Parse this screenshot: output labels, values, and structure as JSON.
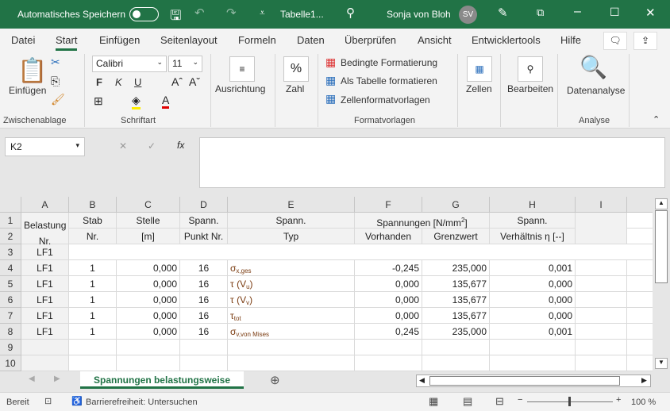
{
  "titlebar": {
    "autosave_label": "Automatisches Speichern",
    "filename": "Tabelle1...",
    "user": "Sonja von Bloh",
    "user_initials": "SV"
  },
  "tabs": [
    "Datei",
    "Start",
    "Einfügen",
    "Seitenlayout",
    "Formeln",
    "Daten",
    "Überprüfen",
    "Ansicht",
    "Entwicklertools",
    "Hilfe"
  ],
  "ribbon": {
    "paste": "Einfügen",
    "font_name": "Calibri",
    "font_size": "11",
    "bold": "F",
    "italic": "K",
    "underline": "U",
    "alignment": "Ausrichtung",
    "number": "Zahl",
    "percent": "%",
    "cond_format": "Bedingte Formatierung",
    "as_table": "Als Tabelle formatieren",
    "cell_styles": "Zellenformatvorlagen",
    "cells": "Zellen",
    "editing": "Bearbeiten",
    "data_analysis": "Datenanalyse",
    "groups": {
      "clipboard": "Zwischenablage",
      "font": "Schriftart",
      "styles": "Formatvorlagen",
      "analysis": "Analyse"
    }
  },
  "formula_bar": {
    "name_box": "K2",
    "fx": "fx",
    "value": ""
  },
  "columns": [
    "A",
    "B",
    "C",
    "D",
    "E",
    "F",
    "G",
    "H",
    "I"
  ],
  "rows": [
    "1",
    "2",
    "3",
    "4",
    "5",
    "6",
    "7",
    "8",
    "9",
    "10"
  ],
  "headers": {
    "a": "Belastung",
    "a2": "Nr.",
    "b": "Stab",
    "b2": "Nr.",
    "c": "Stelle",
    "c2": "[m]",
    "d": "Spann.",
    "d2": "Punkt Nr.",
    "e": "Spann.",
    "e2": "Typ",
    "fg": "Spannungen [N/mm",
    "fg_sup": "2",
    "fg_end": "]",
    "f2": "Vorhanden",
    "g2": "Grenzwert",
    "h": "Spann.",
    "h2": "Verhältnis η [--]"
  },
  "row3": {
    "a": "LF1"
  },
  "data": [
    {
      "a": "LF1",
      "b": "1",
      "c": "0,000",
      "d": "16",
      "type": "σ",
      "sub": "x,ges",
      "tail": "",
      "f": "-0,245",
      "g": "235,000",
      "h": "0,001"
    },
    {
      "a": "LF1",
      "b": "1",
      "c": "0,000",
      "d": "16",
      "type": "τ (V",
      "sub": "u",
      "tail": ")",
      "f": "0,000",
      "g": "135,677",
      "h": "0,000"
    },
    {
      "a": "LF1",
      "b": "1",
      "c": "0,000",
      "d": "16",
      "type": "τ (V",
      "sub": "v",
      "tail": ")",
      "f": "0,000",
      "g": "135,677",
      "h": "0,000"
    },
    {
      "a": "LF1",
      "b": "1",
      "c": "0,000",
      "d": "16",
      "type": "τ",
      "sub": "tot",
      "tail": "",
      "f": "0,000",
      "g": "135,677",
      "h": "0,000"
    },
    {
      "a": "LF1",
      "b": "1",
      "c": "0,000",
      "d": "16",
      "type": "σ",
      "sub": "v,von Mises",
      "tail": "",
      "f": "0,245",
      "g": "235,000",
      "h": "0,001"
    }
  ],
  "sheet_tab": "Spannungen belastungsweise",
  "status": {
    "ready": "Bereit",
    "accessibility": "Barrierefreiheit: Untersuchen",
    "zoom": "100 %"
  }
}
